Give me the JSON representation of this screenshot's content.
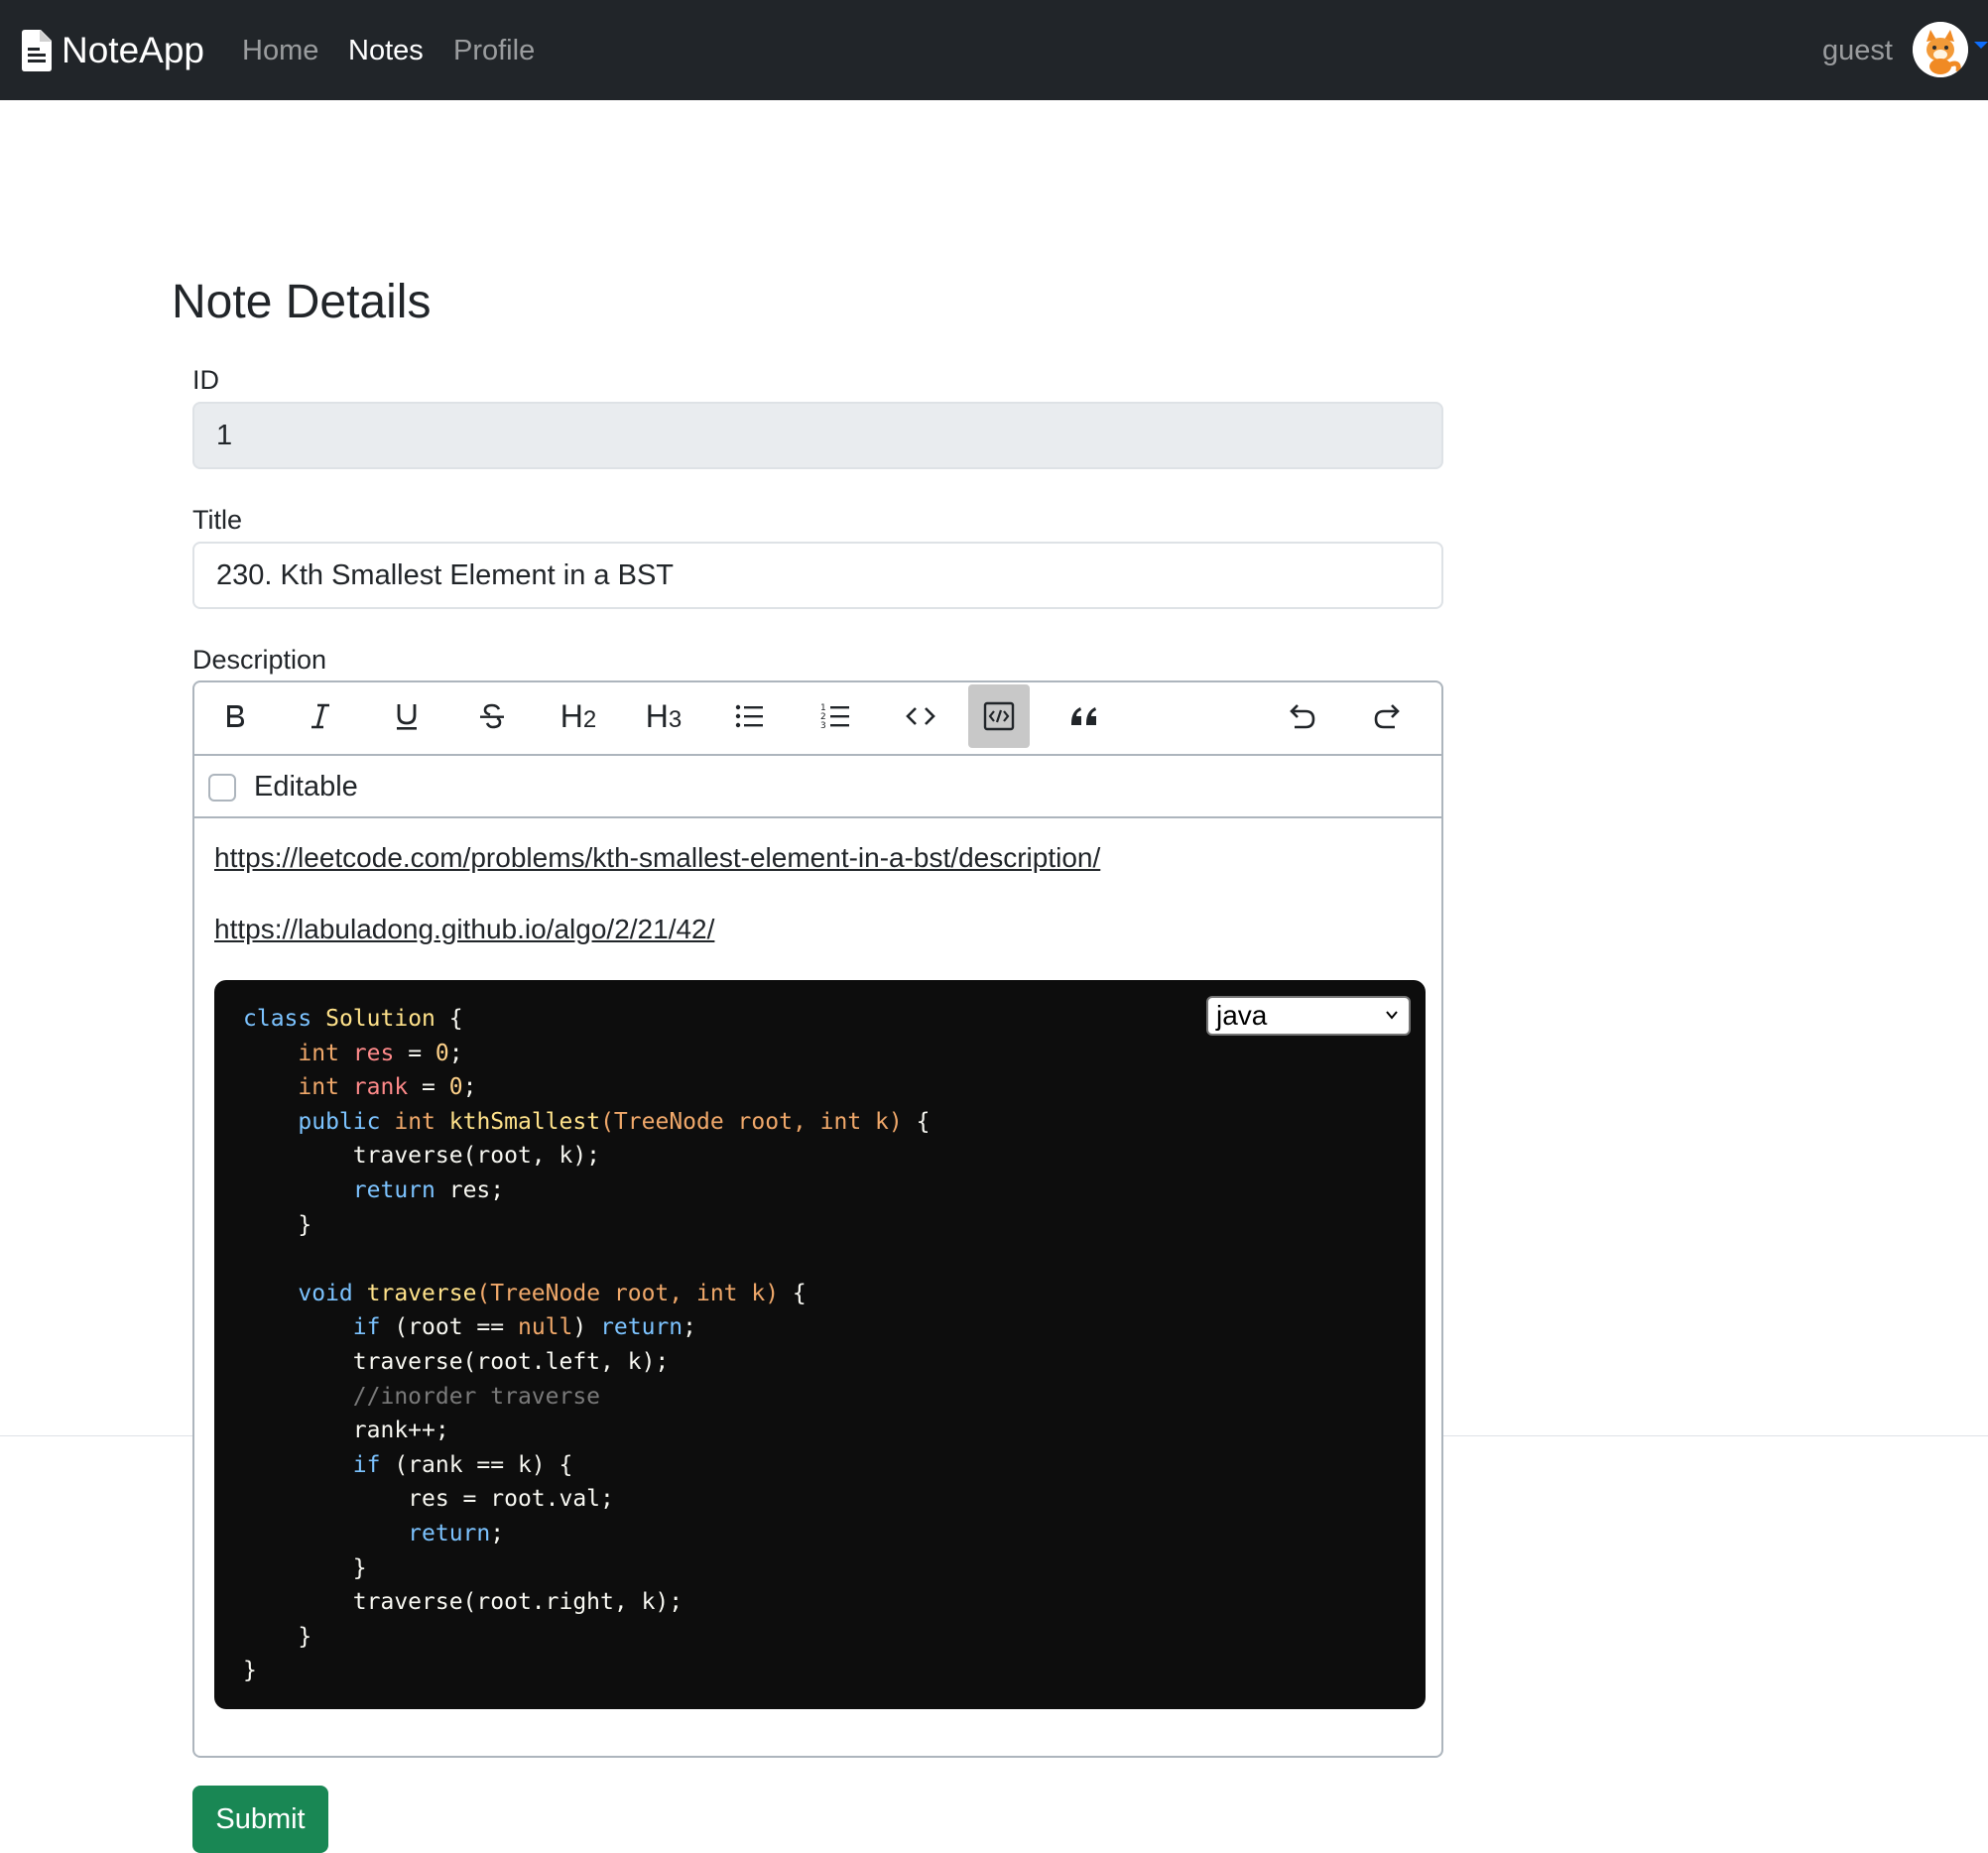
{
  "navbar": {
    "brand": "NoteApp",
    "links": [
      "Home",
      "Notes",
      "Profile"
    ],
    "active_link": "Notes",
    "user": "guest"
  },
  "page": {
    "title": "Note Details"
  },
  "form": {
    "id_label": "ID",
    "id_value": "1",
    "title_label": "Title",
    "title_value": "230. Kth Smallest Element in a BST",
    "description_label": "Description",
    "editable_label": "Editable",
    "editable_checked": false,
    "submit_label": "Submit"
  },
  "toolbar": {
    "buttons": [
      "bold-icon",
      "italic-icon",
      "underline-icon",
      "strikethrough-icon",
      "H2",
      "H3",
      "bullet-list-icon",
      "ordered-list-icon",
      "code-icon",
      "code-block-icon",
      "blockquote-icon",
      "undo-icon",
      "redo-icon"
    ],
    "active": "code-block-icon"
  },
  "description": {
    "links": [
      "https://leetcode.com/problems/kth-smallest-element-in-a-bst/description/",
      "https://labuladong.github.io/algo/2/21/42/"
    ],
    "code_language": "java"
  },
  "colors": {
    "navbar_bg": "#212529",
    "submit_bg": "#198754",
    "code_bg": "#0d0d0d",
    "active_toolbar_bg": "#c8c8c8"
  }
}
